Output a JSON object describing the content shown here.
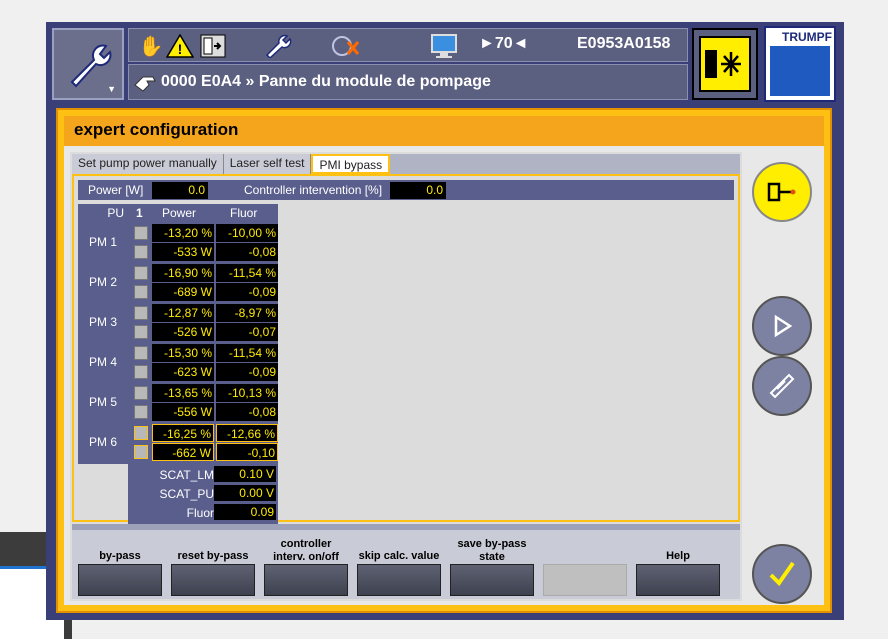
{
  "header": {
    "counter": "►70◄",
    "machine_id": "E0953A0158",
    "message": "0000 E0A4 » Panne du module de pompage",
    "logo": "TRUMPF",
    "icons": [
      "hand-stop-icon",
      "warning-icon",
      "door-icon",
      "wrench-icon",
      "tool-disabled-icon",
      "monitor-icon"
    ]
  },
  "page": {
    "title": "expert configuration",
    "tabs": [
      "Set pump power manually",
      "Laser self test",
      "PMI bypass"
    ],
    "active_tab": "PMI bypass"
  },
  "power": {
    "power_label": "Power [W]",
    "power_value": "0.0",
    "ctrl_label": "Controller intervention [%]",
    "ctrl_value": "0.0"
  },
  "table": {
    "col_pu": "PU",
    "col_num": "1",
    "col_power": "Power",
    "col_fluor": "Fluor",
    "rows": [
      {
        "label": "PM 1",
        "power_pct": "-13,20 %",
        "fluor_pct": "-10,00 %",
        "power_w": "-533 W",
        "fluor_v": "-0,08"
      },
      {
        "label": "PM 2",
        "power_pct": "-16,90 %",
        "fluor_pct": "-11,54 %",
        "power_w": "-689 W",
        "fluor_v": "-0,09"
      },
      {
        "label": "PM 3",
        "power_pct": "-12,87 %",
        "fluor_pct": "-8,97 %",
        "power_w": "-526 W",
        "fluor_v": "-0,07"
      },
      {
        "label": "PM 4",
        "power_pct": "-15,30 %",
        "fluor_pct": "-11,54 %",
        "power_w": "-623 W",
        "fluor_v": "-0,09"
      },
      {
        "label": "PM 5",
        "power_pct": "-13,65 %",
        "fluor_pct": "-10,13 %",
        "power_w": "-556 W",
        "fluor_v": "-0,08"
      },
      {
        "label": "PM 6",
        "power_pct": "-16,25 %",
        "fluor_pct": "-12,66 %",
        "power_w": "-662 W",
        "fluor_v": "-0,10"
      }
    ],
    "scat": [
      {
        "label": "SCAT_LM",
        "value": "0.10 V"
      },
      {
        "label": "SCAT_PU",
        "value": "0.00 V"
      },
      {
        "label": "Fluor",
        "value": "0.09"
      }
    ]
  },
  "buttons": {
    "bypass": "by-pass",
    "reset_bypass": "reset by-pass",
    "controller": "controller interv. on/off",
    "skip_calc": "skip calc. value",
    "save_bypass": "save by-pass state",
    "empty": "",
    "help": "Help"
  },
  "colors": {
    "frame": "#ffc014",
    "title_bar": "#f5a51c",
    "panel_blue": "#5a5e8c",
    "value_text": "#ffea00"
  }
}
